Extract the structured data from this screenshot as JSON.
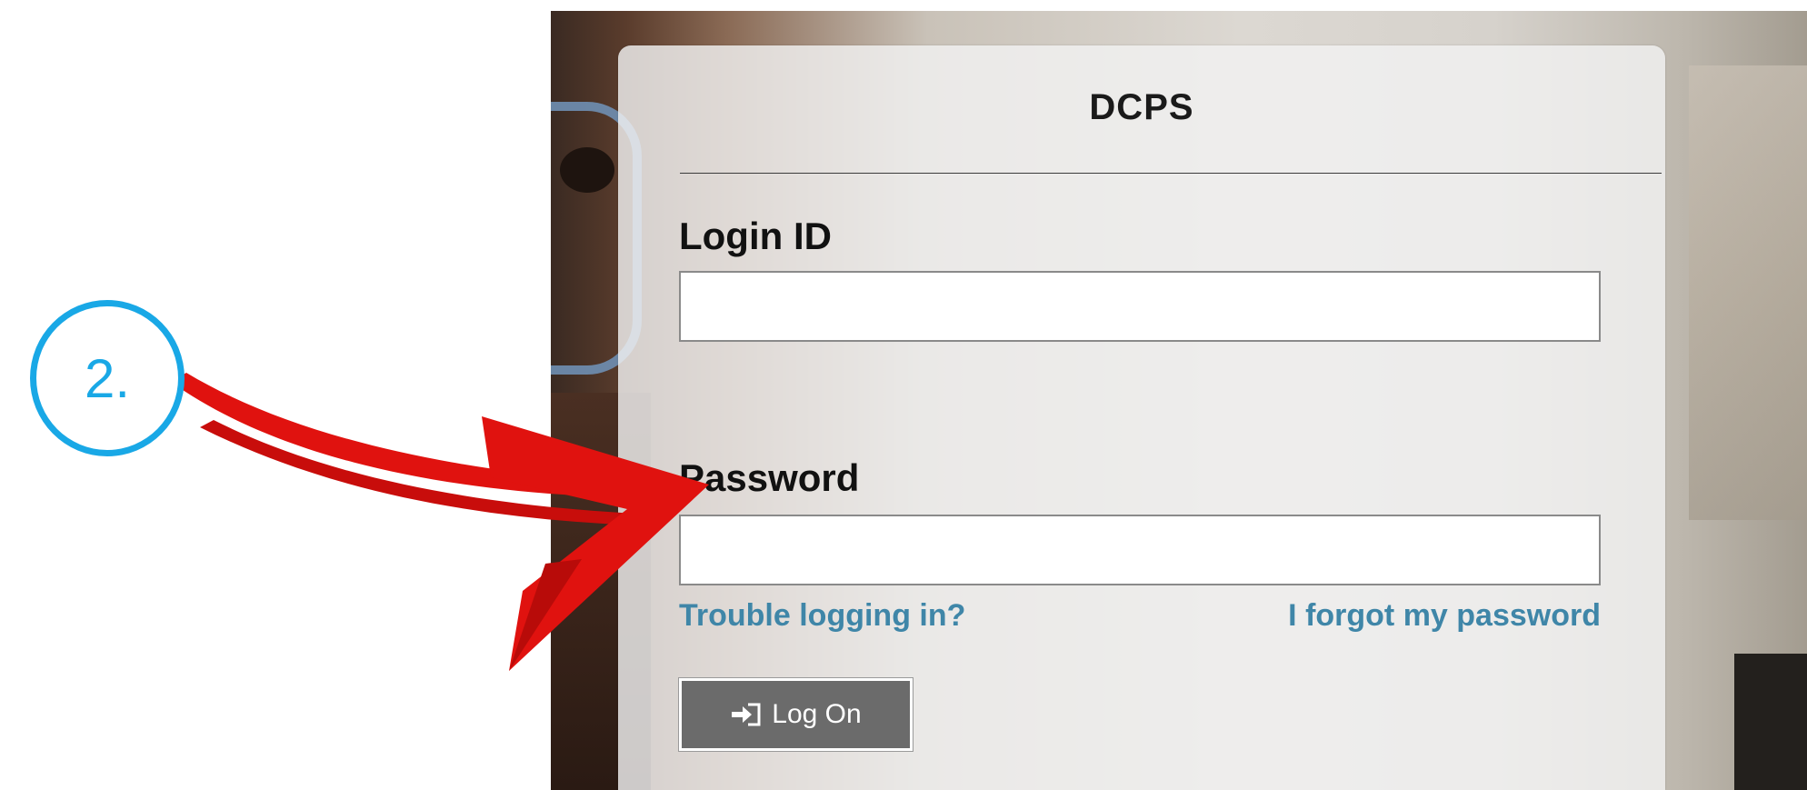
{
  "card": {
    "title": "DCPS",
    "login_label": "Login ID",
    "login_value": "",
    "password_label": "Password",
    "password_value": "",
    "trouble_link": "Trouble logging in?",
    "forgot_link": "I forgot my password",
    "logon_button": "Log On",
    "logon_icon": "sign-in-icon"
  },
  "annotation": {
    "step_label": "2.",
    "step_color": "#19a8e6",
    "arrow_color": "#e0120f"
  },
  "colors": {
    "link": "#3f86a8",
    "button_bg": "#6b6b6b"
  }
}
